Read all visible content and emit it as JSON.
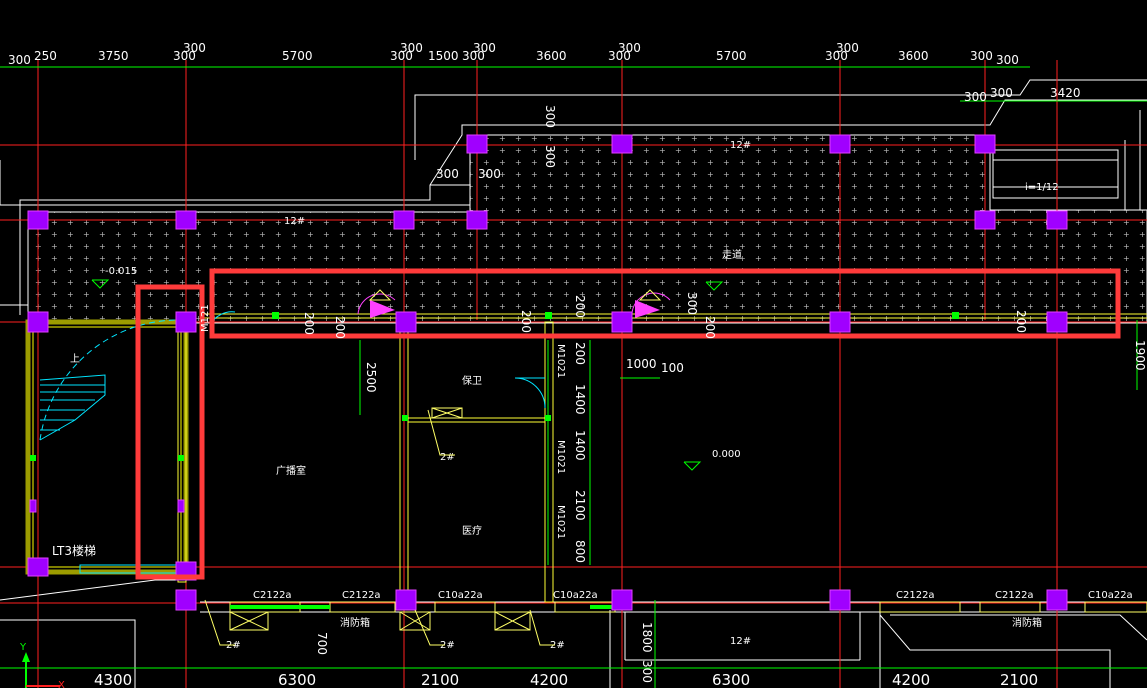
{
  "top_dims_row1": [
    "300",
    "250",
    "3750",
    "300",
    "5700",
    "300",
    "1500",
    "300",
    "3600",
    "300",
    "5700",
    "300",
    "3600",
    "300",
    "300"
  ],
  "top_dims_row1b": [
    "300",
    "300",
    "300",
    "300",
    "300"
  ],
  "top_dims_row2": [
    "300",
    "300",
    "3420"
  ],
  "bottom_dims": [
    "4300",
    "6300",
    "2100",
    "4200",
    "6300",
    "4200",
    "2100"
  ],
  "vertical_dims": [
    "300",
    "300",
    "200",
    "200",
    "2500",
    "200",
    "200",
    "200",
    "1400",
    "1400",
    "2100",
    "800",
    "300",
    "200",
    "1900",
    "200",
    "700",
    "1800",
    "300"
  ],
  "small_dims": [
    "300",
    "300",
    "1000",
    "100"
  ],
  "rooms": {
    "corridor": "走道",
    "guard": "保卫",
    "broadcast": "广播室",
    "medical": "医疗",
    "stair": "LT3楼梯",
    "stair_up": "上"
  },
  "elevations": [
    "-0.015",
    "0.000"
  ],
  "slope": "i=1/12",
  "window_tags": [
    "C2122a",
    "C2122a",
    "C10a22a",
    "C10a22a",
    "C2122a",
    "C2122a",
    "C10a22a"
  ],
  "door_tags": [
    "M121",
    "M1021",
    "M1021",
    "M1021"
  ],
  "small_labels": [
    "12#",
    "12#",
    "12#",
    "2#",
    "2#",
    "2#",
    "2#"
  ],
  "misc_labels": [
    "消防箱",
    "消防箱"
  ],
  "axis": {
    "y": "Y",
    "x": "X"
  },
  "colors": {
    "background": "#000000",
    "axis_line": "#ff2020",
    "column": "#a000ff",
    "dimension": "#00ff00",
    "wall": "#ffffff",
    "highlight": "#ff3b3b",
    "window": "#ffff66",
    "cyan": "#00e5ff"
  }
}
